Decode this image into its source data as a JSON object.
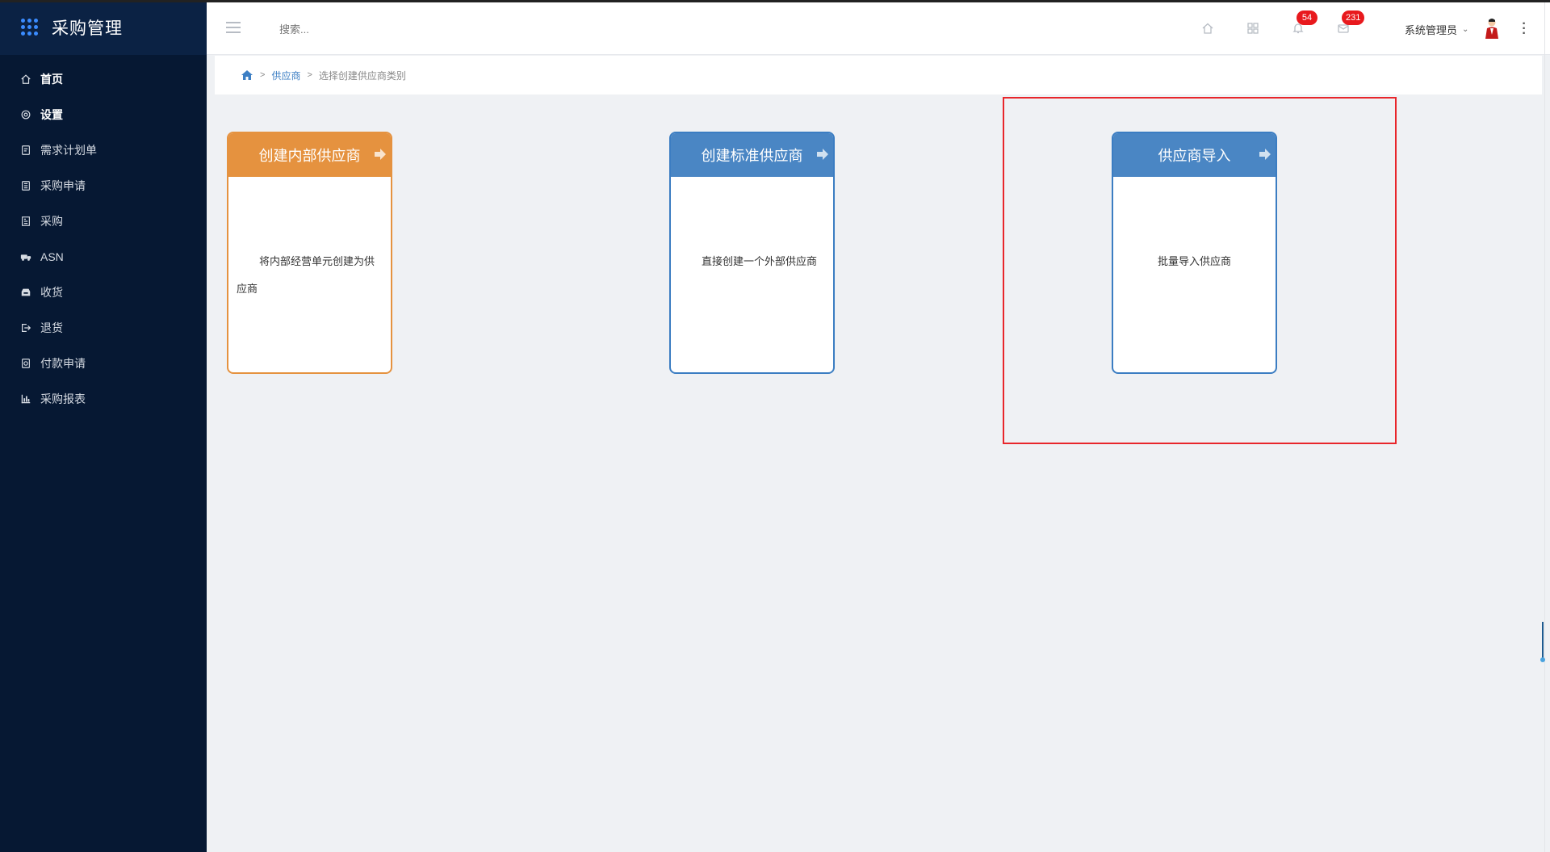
{
  "app": {
    "title": "采购管理"
  },
  "sidebar": {
    "items": [
      {
        "label": "首页",
        "icon": "home-icon",
        "bold": true
      },
      {
        "label": "设置",
        "icon": "gear-icon",
        "bold": true
      },
      {
        "label": "需求计划单",
        "icon": "document-icon"
      },
      {
        "label": "采购申请",
        "icon": "form-icon"
      },
      {
        "label": "采购",
        "icon": "list-icon"
      },
      {
        "label": "ASN",
        "icon": "truck-icon"
      },
      {
        "label": "收货",
        "icon": "inbox-icon"
      },
      {
        "label": "退货",
        "icon": "return-icon"
      },
      {
        "label": "付款申请",
        "icon": "payment-icon"
      },
      {
        "label": "采购报表",
        "icon": "bar-chart-icon"
      }
    ]
  },
  "header": {
    "search_placeholder": "搜索...",
    "notifications_count": "54",
    "messages_count": "231",
    "user_name": "系统管理员"
  },
  "breadcrumb": {
    "link": "供应商",
    "current": "选择创建供应商类别"
  },
  "cards": [
    {
      "title": "创建内部供应商",
      "desc": "将内部经营单元创建为供应商",
      "color": "#e5923f"
    },
    {
      "title": "创建标准供应商",
      "desc": "直接创建一个外部供应商",
      "color": "#4a86c4"
    },
    {
      "title": "供应商导入",
      "desc": "批量导入供应商",
      "color": "#4a86c4"
    }
  ],
  "colors": {
    "sidebar_bg": "#061833",
    "accent_blue": "#3d7fc4",
    "badge_red": "#e8191d",
    "highlight_red": "#e8262b"
  }
}
